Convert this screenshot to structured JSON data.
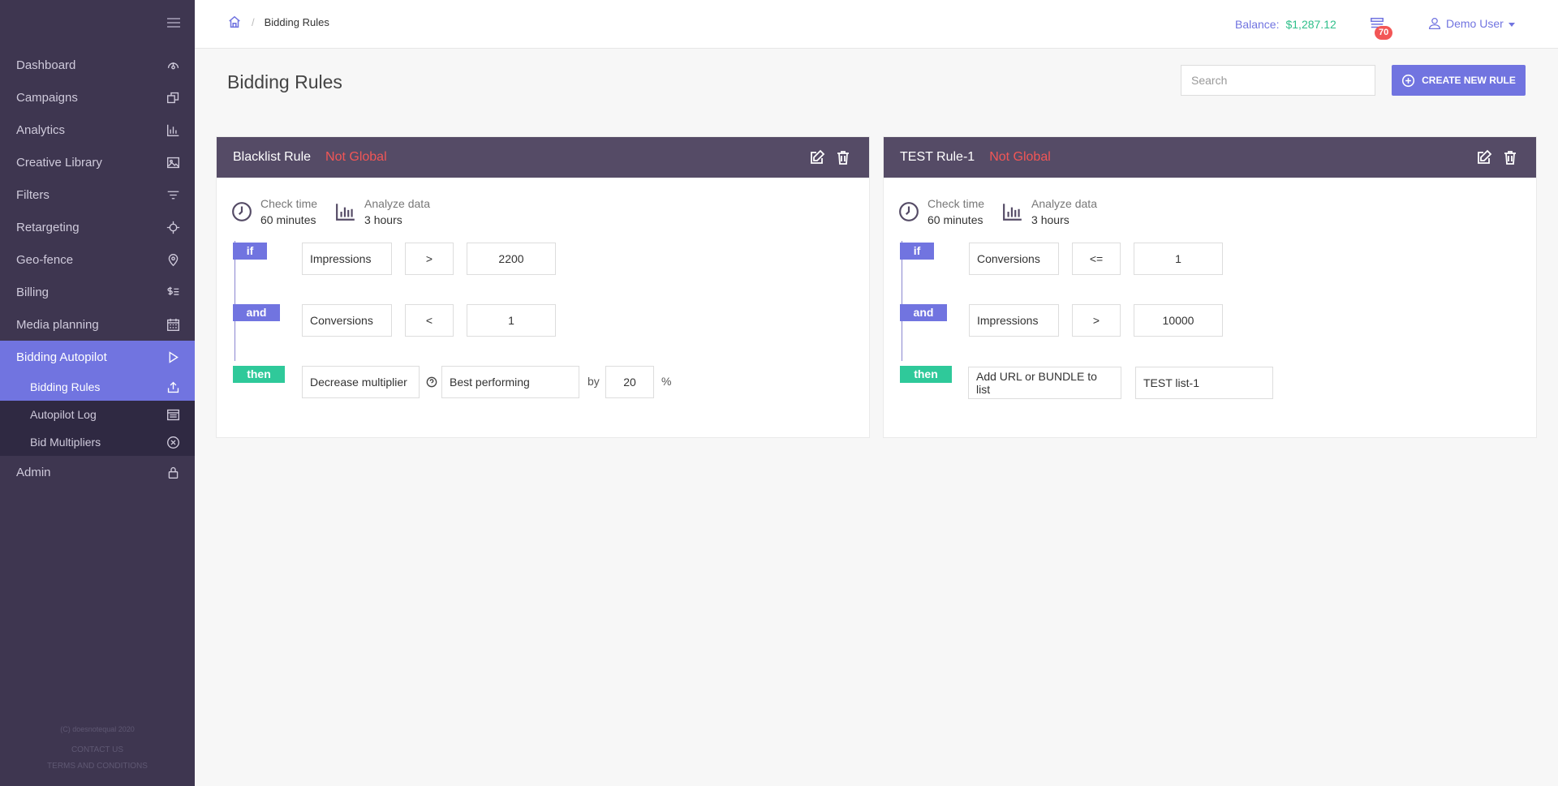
{
  "sidebar": {
    "items": [
      {
        "label": "Dashboard",
        "icon": "dashboard-icon"
      },
      {
        "label": "Campaigns",
        "icon": "campaigns-icon"
      },
      {
        "label": "Analytics",
        "icon": "analytics-icon"
      },
      {
        "label": "Creative Library",
        "icon": "image-icon"
      },
      {
        "label": "Filters",
        "icon": "filter-icon"
      },
      {
        "label": "Retargeting",
        "icon": "crosshair-icon"
      },
      {
        "label": "Geo-fence",
        "icon": "location-pin-icon"
      },
      {
        "label": "Billing",
        "icon": "billing-icon"
      },
      {
        "label": "Media planning",
        "icon": "calendar-icon"
      },
      {
        "label": "Bidding Autopilot",
        "icon": "play-icon"
      }
    ],
    "subitems": [
      {
        "label": "Bidding Rules",
        "icon": "upload-icon"
      },
      {
        "label": "Autopilot Log",
        "icon": "log-icon"
      },
      {
        "label": "Bid Multipliers",
        "icon": "circle-x-icon"
      }
    ],
    "admin": {
      "label": "Admin",
      "icon": "lock-icon"
    },
    "footer": {
      "copyright": "(C) doesnotequal 2020",
      "contact": "CONTACT US",
      "terms": "TERMS AND CONDITIONS"
    }
  },
  "topbar": {
    "breadcrumb": "Bidding Rules",
    "balance_label": "Balance:",
    "balance_amount": "$1,287.12",
    "notifications_count": "70",
    "user_name": "Demo User"
  },
  "page": {
    "title": "Bidding Rules",
    "search_placeholder": "Search",
    "create_label": "CREATE NEW RULE"
  },
  "rules": [
    {
      "title": "Blacklist Rule",
      "status": "Not Global",
      "check_time_label": "Check time",
      "check_time_value": "60 minutes",
      "analyze_label": "Analyze data",
      "analyze_value": "3 hours",
      "if_kw": "if",
      "and_kw": "and",
      "then_kw": "then",
      "if": {
        "metric": "Impressions",
        "op": ">",
        "value": "2200"
      },
      "and": {
        "metric": "Conversions",
        "op": "<",
        "value": "1"
      },
      "then": {
        "action": "Decrease multiplier",
        "target": "Best performing",
        "by": "by",
        "value": "20",
        "unit": "%"
      }
    },
    {
      "title": "TEST Rule-1",
      "status": "Not Global",
      "check_time_label": "Check time",
      "check_time_value": "60 minutes",
      "analyze_label": "Analyze data",
      "analyze_value": "3 hours",
      "if_kw": "if",
      "and_kw": "and",
      "then_kw": "then",
      "if": {
        "metric": "Conversions",
        "op": "<=",
        "value": "1"
      },
      "and": {
        "metric": "Impressions",
        "op": ">",
        "value": "10000"
      },
      "then": {
        "action": "Add URL or BUNDLE to list",
        "target": "TEST list-1"
      }
    }
  ],
  "colors": {
    "sidebar_bg": "#3e3650",
    "accent": "#7174e0",
    "card_header": "#554b66",
    "danger": "#f25656",
    "success": "#2fc99a"
  }
}
